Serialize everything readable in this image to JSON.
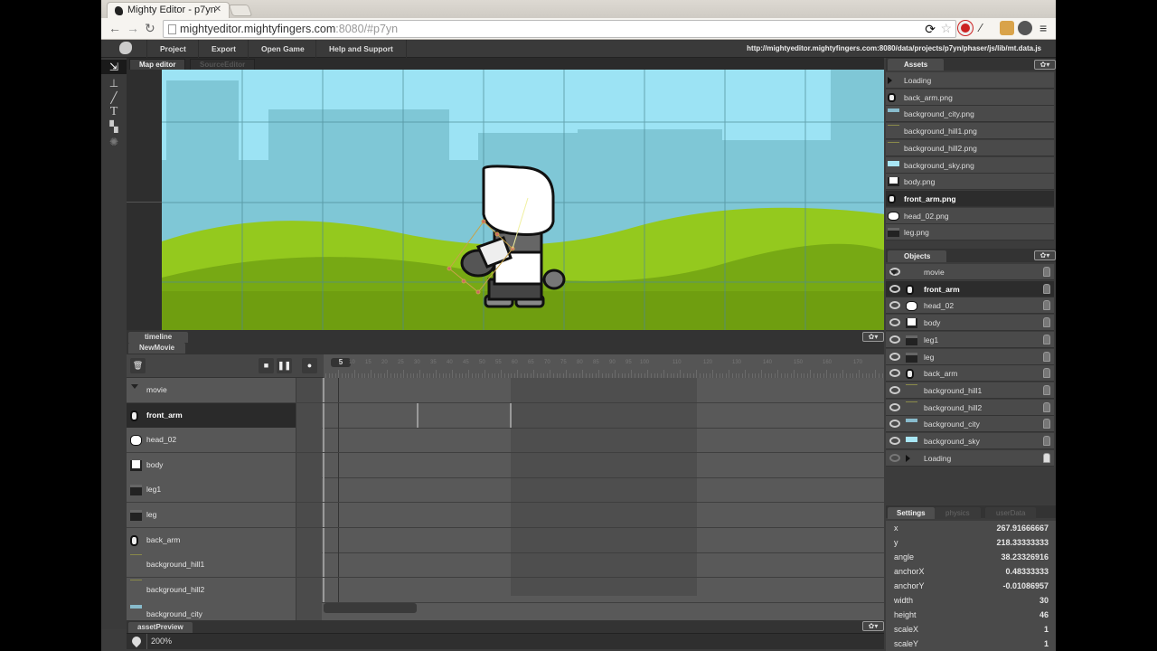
{
  "browser": {
    "tab_title": "Mighty Editor - p7yn",
    "url_host": "mightyeditor.mightyfingers.com",
    "url_rest": ":8080/#p7yn",
    "icons": [
      "back-icon",
      "forward-icon",
      "reload-icon",
      "page-icon",
      "refresh-icon",
      "star-icon",
      "adblock-icon",
      "eyedropper-icon",
      "extension-icon",
      "globe-icon",
      "menu-icon"
    ]
  },
  "menu": {
    "items": [
      "Project",
      "Export",
      "Open Game",
      "Help and Support"
    ],
    "data_url": "http://mightyeditor.mightyfingers.com:8080/data/projects/p7yn/phaser/js/lib/mt.data.js"
  },
  "tools": [
    "move-tool",
    "stamp-tool",
    "brush-tool",
    "text-tool",
    "tile-tool",
    "physics-tool"
  ],
  "editor_tabs": [
    "Map editor",
    "SourceEditor"
  ],
  "timeline": {
    "tabs": [
      "timeline",
      "NewMovie"
    ],
    "current_frame": "5",
    "ruler_labels": [
      "10",
      "15",
      "20",
      "25",
      "30",
      "35",
      "40",
      "45",
      "50",
      "55",
      "60",
      "65",
      "70",
      "75",
      "80",
      "85",
      "90",
      "95",
      "100",
      "110",
      "120",
      "130",
      "140",
      "150",
      "160",
      "170"
    ],
    "tracks": [
      {
        "name": "movie",
        "icon": "triangle-down",
        "selected": false
      },
      {
        "name": "front_arm",
        "icon": "arm",
        "selected": true
      },
      {
        "name": "head_02",
        "icon": "head",
        "selected": false
      },
      {
        "name": "body",
        "icon": "body",
        "selected": false
      },
      {
        "name": "leg1",
        "icon": "leg",
        "selected": false
      },
      {
        "name": "leg",
        "icon": "leg",
        "selected": false
      },
      {
        "name": "back_arm",
        "icon": "arm",
        "selected": false
      },
      {
        "name": "background_hill1",
        "icon": "hill",
        "selected": false
      },
      {
        "name": "background_hill2",
        "icon": "hill",
        "selected": false
      },
      {
        "name": "background_city",
        "icon": "city",
        "selected": false
      }
    ]
  },
  "asset_preview": {
    "tab": "assetPreview",
    "zoom": "200%"
  },
  "assets": {
    "title": "Assets",
    "items": [
      {
        "name": "Loading",
        "icon": "folder"
      },
      {
        "name": "back_arm.png",
        "icon": "arm"
      },
      {
        "name": "background_city.png",
        "icon": "city"
      },
      {
        "name": "background_hill1.png",
        "icon": "hill"
      },
      {
        "name": "background_hill2.png",
        "icon": "hill"
      },
      {
        "name": "background_sky.png",
        "icon": "sky"
      },
      {
        "name": "body.png",
        "icon": "body"
      },
      {
        "name": "front_arm.png",
        "icon": "arm",
        "selected": true
      },
      {
        "name": "head_02.png",
        "icon": "head"
      },
      {
        "name": "leg.png",
        "icon": "leg"
      }
    ]
  },
  "objects": {
    "title": "Objects",
    "items": [
      {
        "name": "movie",
        "icon": "triangle-down"
      },
      {
        "name": "front_arm",
        "icon": "arm",
        "selected": true
      },
      {
        "name": "head_02",
        "icon": "head"
      },
      {
        "name": "body",
        "icon": "body"
      },
      {
        "name": "leg1",
        "icon": "leg"
      },
      {
        "name": "leg",
        "icon": "leg"
      },
      {
        "name": "back_arm",
        "icon": "arm"
      },
      {
        "name": "background_hill1",
        "icon": "hill"
      },
      {
        "name": "background_hill2",
        "icon": "hill"
      },
      {
        "name": "background_city",
        "icon": "city"
      },
      {
        "name": "background_sky",
        "icon": "sky"
      },
      {
        "name": "Loading",
        "icon": "triangle-right",
        "locked": true
      }
    ]
  },
  "settings": {
    "tabs": [
      "Settings",
      "physics",
      "userData"
    ],
    "props": [
      {
        "key": "x",
        "value": "267.91666667"
      },
      {
        "key": "y",
        "value": "218.33333333"
      },
      {
        "key": "angle",
        "value": "38.23326916"
      },
      {
        "key": "anchorX",
        "value": "0.48333333"
      },
      {
        "key": "anchorY",
        "value": "-0.01086957"
      },
      {
        "key": "width",
        "value": "30"
      },
      {
        "key": "height",
        "value": "46"
      },
      {
        "key": "scaleX",
        "value": "1"
      },
      {
        "key": "scaleY",
        "value": "1"
      }
    ]
  },
  "colors": {
    "sky": "#9ce3f4",
    "hill": "#8cc21c",
    "panel": "#3c3c3c",
    "selected": "#2a2a2a"
  }
}
